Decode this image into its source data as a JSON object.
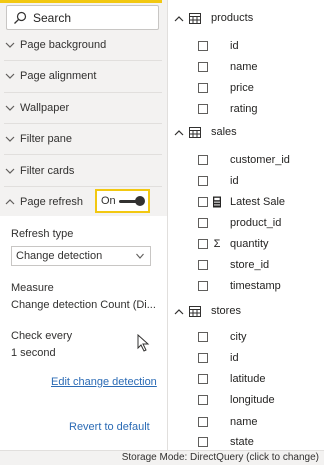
{
  "search": {
    "placeholder": "Search"
  },
  "format_pane": {
    "sections": [
      {
        "label": "Page background",
        "expanded": false
      },
      {
        "label": "Page alignment",
        "expanded": false
      },
      {
        "label": "Wallpaper",
        "expanded": false
      },
      {
        "label": "Filter pane",
        "expanded": false
      },
      {
        "label": "Filter cards",
        "expanded": false
      },
      {
        "label": "Page refresh",
        "expanded": true
      }
    ],
    "page_refresh": {
      "toggle_label": "On",
      "toggle_state": true,
      "refresh_type_label": "Refresh type",
      "refresh_type_value": "Change detection",
      "measure_label": "Measure",
      "measure_value": "Change detection Count (Di...",
      "check_every_label": "Check every",
      "check_every_value": "1 second",
      "edit_link": "Edit change detection",
      "revert_link": "Revert to default"
    }
  },
  "fields_pane": {
    "tables": [
      {
        "name": "products",
        "fields": [
          {
            "name": "id",
            "icon": ""
          },
          {
            "name": "name",
            "icon": ""
          },
          {
            "name": "price",
            "icon": ""
          },
          {
            "name": "rating",
            "icon": ""
          }
        ]
      },
      {
        "name": "sales",
        "fields": [
          {
            "name": "customer_id",
            "icon": ""
          },
          {
            "name": "id",
            "icon": ""
          },
          {
            "name": "Latest Sale",
            "icon": "calculator-icon"
          },
          {
            "name": "product_id",
            "icon": ""
          },
          {
            "name": "quantity",
            "icon": "sigma-icon"
          },
          {
            "name": "store_id",
            "icon": ""
          },
          {
            "name": "timestamp",
            "icon": ""
          }
        ]
      },
      {
        "name": "stores",
        "fields": [
          {
            "name": "city",
            "icon": ""
          },
          {
            "name": "id",
            "icon": ""
          },
          {
            "name": "latitude",
            "icon": ""
          },
          {
            "name": "longitude",
            "icon": ""
          },
          {
            "name": "name",
            "icon": ""
          },
          {
            "name": "state",
            "icon": ""
          }
        ]
      }
    ]
  },
  "status_bar": {
    "text": "Storage Mode: DirectQuery (click to change)"
  },
  "colors": {
    "accent": "#f2c811",
    "link": "#2b6bb5",
    "pane_bg": "#f3f2f1"
  }
}
